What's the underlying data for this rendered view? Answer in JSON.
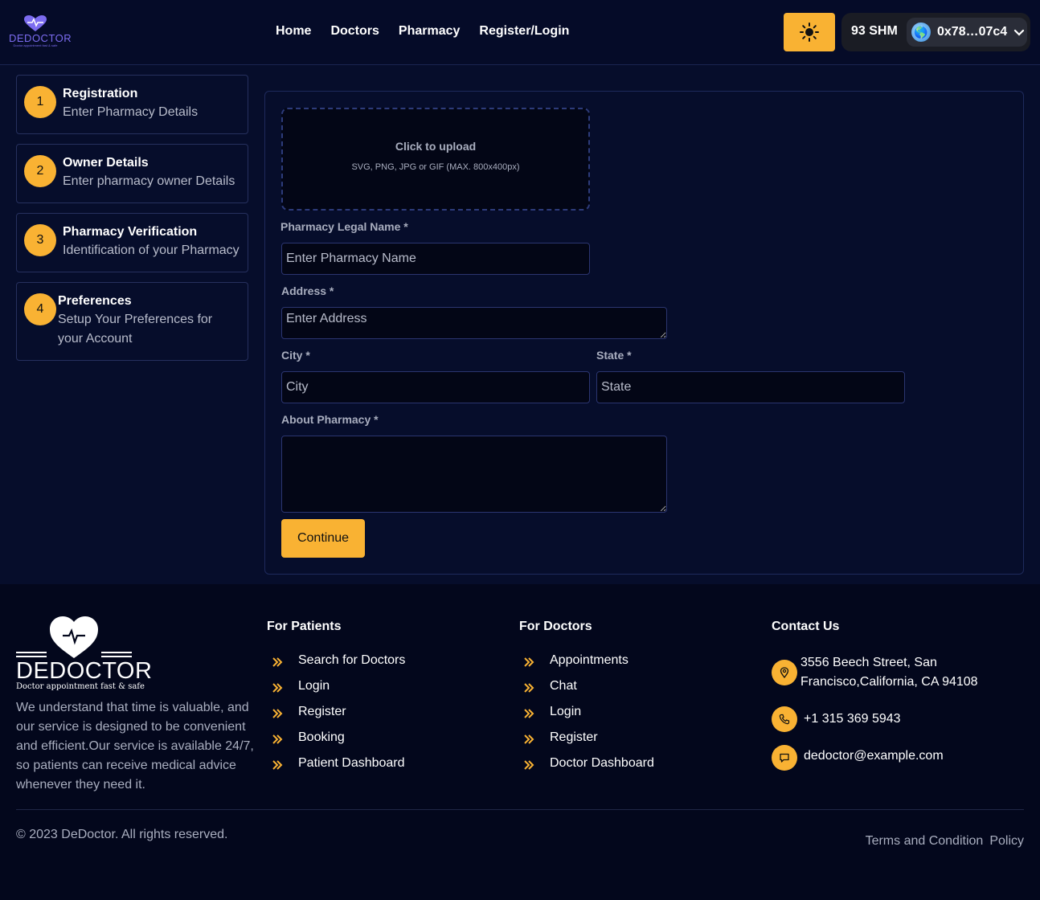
{
  "header": {
    "logo_text": "DEDOCTOR",
    "logo_tagline": "Doctor appointment fast & safe",
    "nav": [
      "Home",
      "Doctors",
      "Pharmacy",
      "Register/Login"
    ],
    "theme_icon": "sun-icon",
    "balance": "93 SHM",
    "account": "0x78…07c4"
  },
  "steps": [
    {
      "num": "1",
      "title": "Registration",
      "subtitle": "Enter Pharmacy Details"
    },
    {
      "num": "2",
      "title": "Owner Details",
      "subtitle": "Enter pharmacy owner Details"
    },
    {
      "num": "3",
      "title": "Pharmacy Verification",
      "subtitle": "Identification of your Pharmacy"
    },
    {
      "num": "4",
      "title": "Preferences",
      "subtitle": "Setup Your Preferences for your Account"
    }
  ],
  "form": {
    "upload_title": "Click to upload",
    "upload_hint": "SVG, PNG, JPG or GIF (MAX. 800x400px)",
    "name_label": "Pharmacy Legal Name *",
    "name_placeholder": "Enter Pharmacy Name",
    "address_label": "Address *",
    "address_placeholder": "Enter Address",
    "city_label": "City *",
    "city_placeholder": "City",
    "state_label": "State *",
    "state_placeholder": "State",
    "about_label": "About Pharmacy *",
    "continue_label": "Continue"
  },
  "footer": {
    "logo_text": "DEDOCTOR",
    "logo_tagline": "Doctor appointment fast & safe",
    "about": "We understand that time is valuable, and our service is designed to be convenient and efficient.Our service is available 24/7, so patients can receive medical advice whenever they need it.",
    "patients_heading": "For Patients",
    "patients_links": [
      "Search for Doctors",
      "Login",
      "Register",
      "Booking",
      "Patient Dashboard"
    ],
    "doctors_heading": "For Doctors",
    "doctors_links": [
      "Appointments",
      "Chat",
      "Login",
      "Register",
      "Doctor Dashboard"
    ],
    "contact_heading": "Contact Us",
    "address": "3556 Beech Street, San Francisco,California, CA 94108",
    "phone": "+1 315 369 5943",
    "email": "dedoctor@example.com",
    "copyright": "© 2023 DeDoctor. All rights reserved.",
    "terms": "Terms and Condition",
    "policy": "Policy"
  },
  "colors": {
    "accent": "#f9b233",
    "background": "#060d2b",
    "footer_background": "#03071c",
    "brand_purple": "#7c6cf0"
  }
}
